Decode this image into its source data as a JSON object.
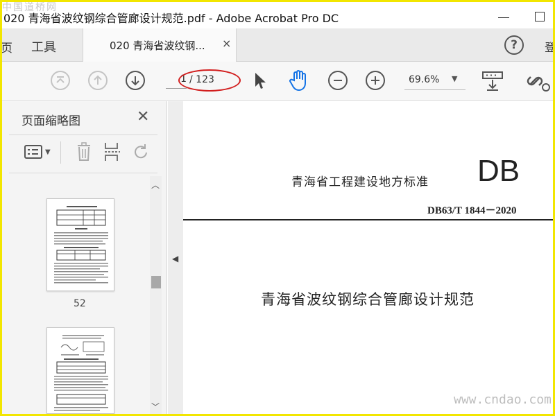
{
  "window": {
    "title": "020 青海省波纹钢综合管廊设计规范.pdf - Adobe Acrobat Pro DC",
    "watermark_top": "中国道桥网"
  },
  "tabs": {
    "home_label": "页",
    "tools_label": "工具",
    "doc_label": "020 青海省波纹钢...",
    "doc_close": "×",
    "right_edge": "登"
  },
  "toolbar": {
    "page_current": "1",
    "page_total": "/ 123",
    "zoom": "69.6%"
  },
  "nav": {
    "title": "页面缩略图",
    "close": "✕",
    "thumb1_label": "52"
  },
  "document": {
    "standard_name": "青海省工程建设地方标准",
    "db_mark": "DB",
    "code": "DB63/T 1844－2020",
    "title": "青海省波纹钢综合管廊设计规范"
  },
  "watermark_bottom": "www.cndao.com",
  "colors": {
    "highlight_ellipse": "#d21e1e",
    "frame_border": "#f2e600",
    "active_tool": "#1473e6"
  }
}
